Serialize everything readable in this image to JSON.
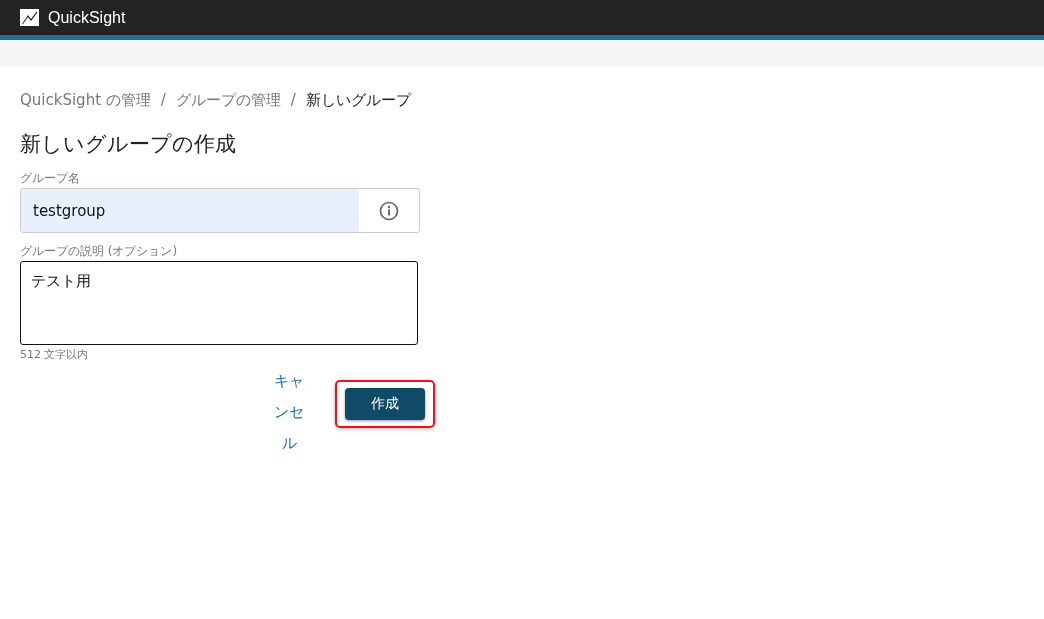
{
  "header": {
    "app_name": "QuickSight"
  },
  "breadcrumb": [
    {
      "label": "QuickSight の管理",
      "current": false
    },
    {
      "label": "グループの管理",
      "current": false
    },
    {
      "label": "新しいグループ",
      "current": true
    }
  ],
  "breadcrumb_separator": "/",
  "page_title": "新しいグループの作成",
  "group_name": {
    "label": "グループ名",
    "value": "testgroup",
    "autofilled": true
  },
  "description": {
    "label": "グループの説明 (オプション)",
    "value": "テスト用",
    "hint": "512 文字以内"
  },
  "buttons": [
    {
      "kind": "link",
      "label": "キャンセル",
      "highlighted": false
    },
    {
      "kind": "primary",
      "label": "作成",
      "highlighted": true
    }
  ]
}
